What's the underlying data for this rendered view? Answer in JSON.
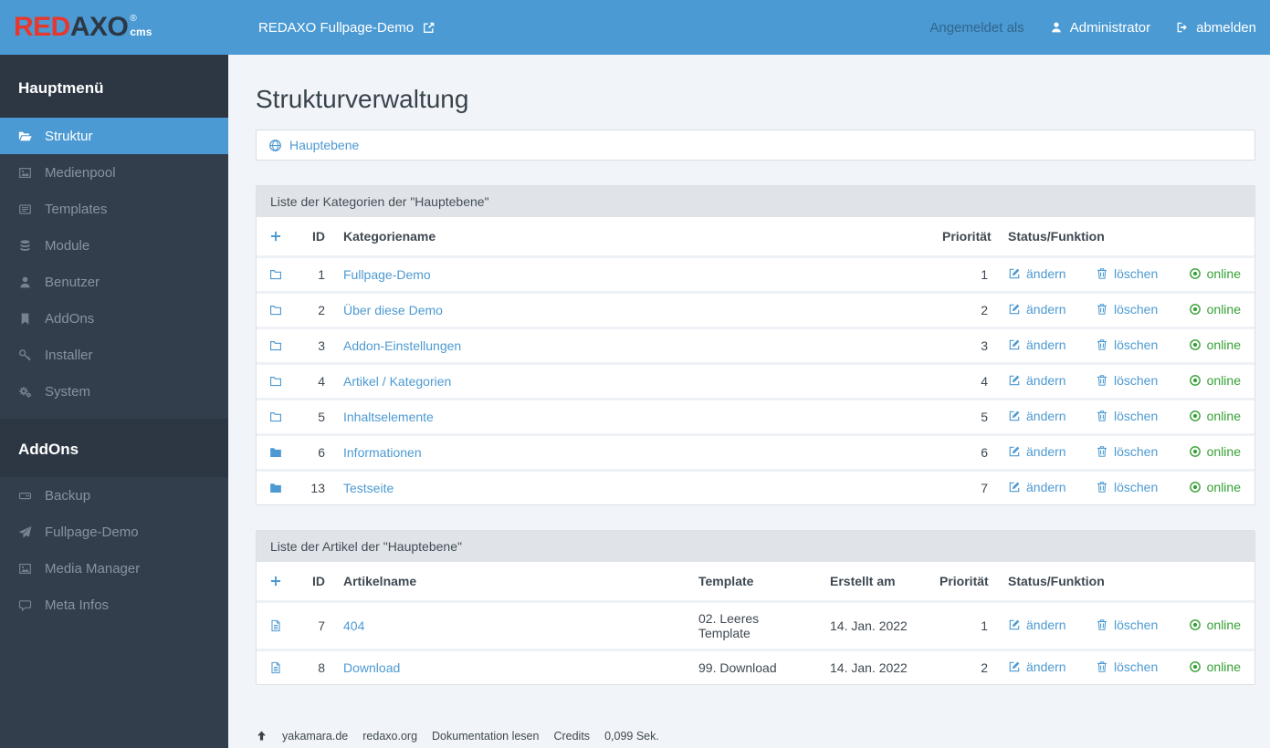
{
  "colors": {
    "topbar": "#4b9ad3",
    "logo_red": "#e8372c",
    "logo_dark": "#2d3845",
    "sidebar_bg": "#333e4c",
    "sidebar_section_bg": "#2d3744",
    "active_item_bg": "#4b9ad3",
    "content_bg": "#f1f4f8",
    "panel_header_bg": "#e0e4e9",
    "link_blue": "#4d9ad2",
    "online_green": "#35a035",
    "text": "#3f4952"
  },
  "header": {
    "logo": {
      "part_red": "RED",
      "part_dark": "AXO",
      "registered": "®",
      "cms": "cms"
    },
    "site_link_label": "REDAXO Fullpage-Demo",
    "site_link_icon": "external-link-icon",
    "logged_in_label": "Angemeldet als",
    "user_name": "Administrator",
    "user_icon": "user-icon",
    "logout_label": "abmelden",
    "logout_icon": "sign-out-icon"
  },
  "sidebar": {
    "sections": [
      {
        "title": "Hauptmenü",
        "items": [
          {
            "label": "Struktur",
            "icon": "folder-open-icon",
            "active": true
          },
          {
            "label": "Medienpool",
            "icon": "image-icon"
          },
          {
            "label": "Templates",
            "icon": "newspaper-icon"
          },
          {
            "label": "Module",
            "icon": "database-icon"
          },
          {
            "label": "Benutzer",
            "icon": "user-icon"
          },
          {
            "label": "AddOns",
            "icon": "bookmark-icon"
          },
          {
            "label": "Installer",
            "icon": "key-icon"
          },
          {
            "label": "System",
            "icon": "gears-icon"
          }
        ]
      },
      {
        "title": "AddOns",
        "items": [
          {
            "label": "Backup",
            "icon": "hdd-icon"
          },
          {
            "label": "Fullpage-Demo",
            "icon": "paper-plane-icon"
          },
          {
            "label": "Media Manager",
            "icon": "image-icon"
          },
          {
            "label": "Meta Infos",
            "icon": "comment-icon"
          }
        ]
      }
    ]
  },
  "main": {
    "page_title": "Strukturverwaltung",
    "breadcrumb": {
      "root_label": "Hauptebene",
      "icon": "globe-icon"
    },
    "actions": {
      "edit": "ändern",
      "edit_icon": "edit-icon",
      "delete": "löschen",
      "delete_icon": "trash-icon",
      "online": "online",
      "online_icon": "dot-circle-icon"
    },
    "add_icon": "plus-icon",
    "categories": {
      "panel_title": "Liste der Kategorien der \"Hauptebene\"",
      "columns": {
        "id": "ID",
        "name": "Kategoriename",
        "priority": "Priorität",
        "status": "Status/Funktion"
      },
      "rows": [
        {
          "id": "1",
          "name": "Fullpage-Demo",
          "priority": "1",
          "folder": "outline"
        },
        {
          "id": "2",
          "name": "Über diese Demo",
          "priority": "2",
          "folder": "outline"
        },
        {
          "id": "3",
          "name": "Addon-Einstellungen",
          "priority": "3",
          "folder": "outline"
        },
        {
          "id": "4",
          "name": "Artikel / Kategorien",
          "priority": "4",
          "folder": "outline"
        },
        {
          "id": "5",
          "name": "Inhaltselemente",
          "priority": "5",
          "folder": "outline"
        },
        {
          "id": "6",
          "name": "Informationen",
          "priority": "6",
          "folder": "filled"
        },
        {
          "id": "13",
          "name": "Testseite",
          "priority": "7",
          "folder": "filled"
        }
      ]
    },
    "articles": {
      "panel_title": "Liste der Artikel der \"Hauptebene\"",
      "columns": {
        "id": "ID",
        "name": "Artikelname",
        "template": "Template",
        "created": "Erstellt am",
        "priority": "Priorität",
        "status": "Status/Funktion"
      },
      "rows": [
        {
          "id": "7",
          "name": "404",
          "template": "02. Leeres Template",
          "created": "14. Jan. 2022",
          "priority": "1"
        },
        {
          "id": "8",
          "name": "Download",
          "template": "99. Download",
          "created": "14. Jan. 2022",
          "priority": "2"
        }
      ]
    },
    "footer": {
      "top_icon": "arrow-up-icon",
      "links": [
        "yakamara.de",
        "redaxo.org",
        "Dokumentation lesen",
        "Credits"
      ],
      "generation_time": "0,099 Sek."
    }
  }
}
